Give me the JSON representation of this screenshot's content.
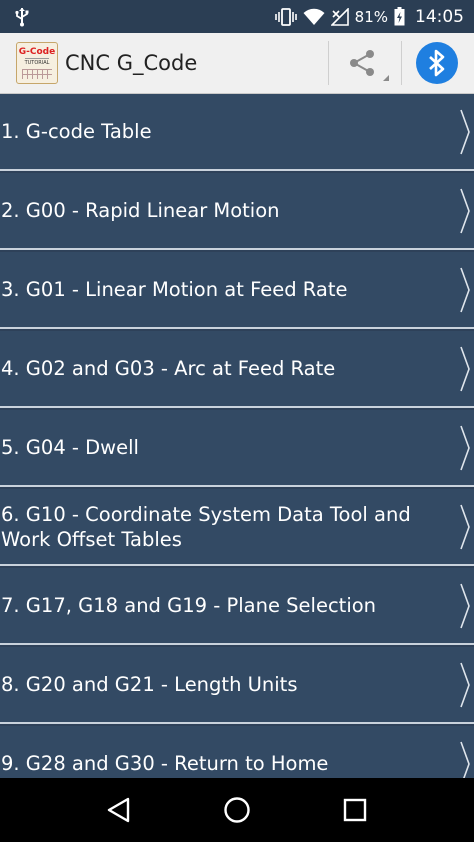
{
  "status_bar": {
    "battery": "81%",
    "time": "14:05",
    "icons": [
      "usb-icon",
      "vibrate-icon",
      "wifi-icon",
      "cell-signal-icon",
      "battery-icon"
    ]
  },
  "action_bar": {
    "title": "CNC G_Code",
    "logo_text_top": "G-Code",
    "logo_text_bottom": "TUTORIAL",
    "share_icon": "share-icon",
    "bluetooth_icon": "bluetooth-icon",
    "bluetooth_color": "#1f7fe0"
  },
  "topics": [
    {
      "label": "1. G-code Table"
    },
    {
      "label": "2. G00 - Rapid Linear Motion"
    },
    {
      "label": "3. G01 - Linear Motion at Feed Rate"
    },
    {
      "label": "4. G02 and G03 - Arc at Feed Rate"
    },
    {
      "label": "5. G04 - Dwell"
    },
    {
      "label": "6. G10 - Coordinate System Data Tool and Work Offset Tables"
    },
    {
      "label": "7. G17, G18 and G19 - Plane Selection"
    },
    {
      "label": "8. G20 and G21 - Length Units"
    },
    {
      "label": "9. G28 and G30 - Return to Home"
    }
  ],
  "nav_bar": {
    "buttons": [
      "back-icon",
      "home-icon",
      "recents-icon"
    ]
  },
  "colors": {
    "list_bg": "#334a64",
    "status_bar_bg": "#2b3e54",
    "action_bar_bg": "#f0f0f0"
  }
}
